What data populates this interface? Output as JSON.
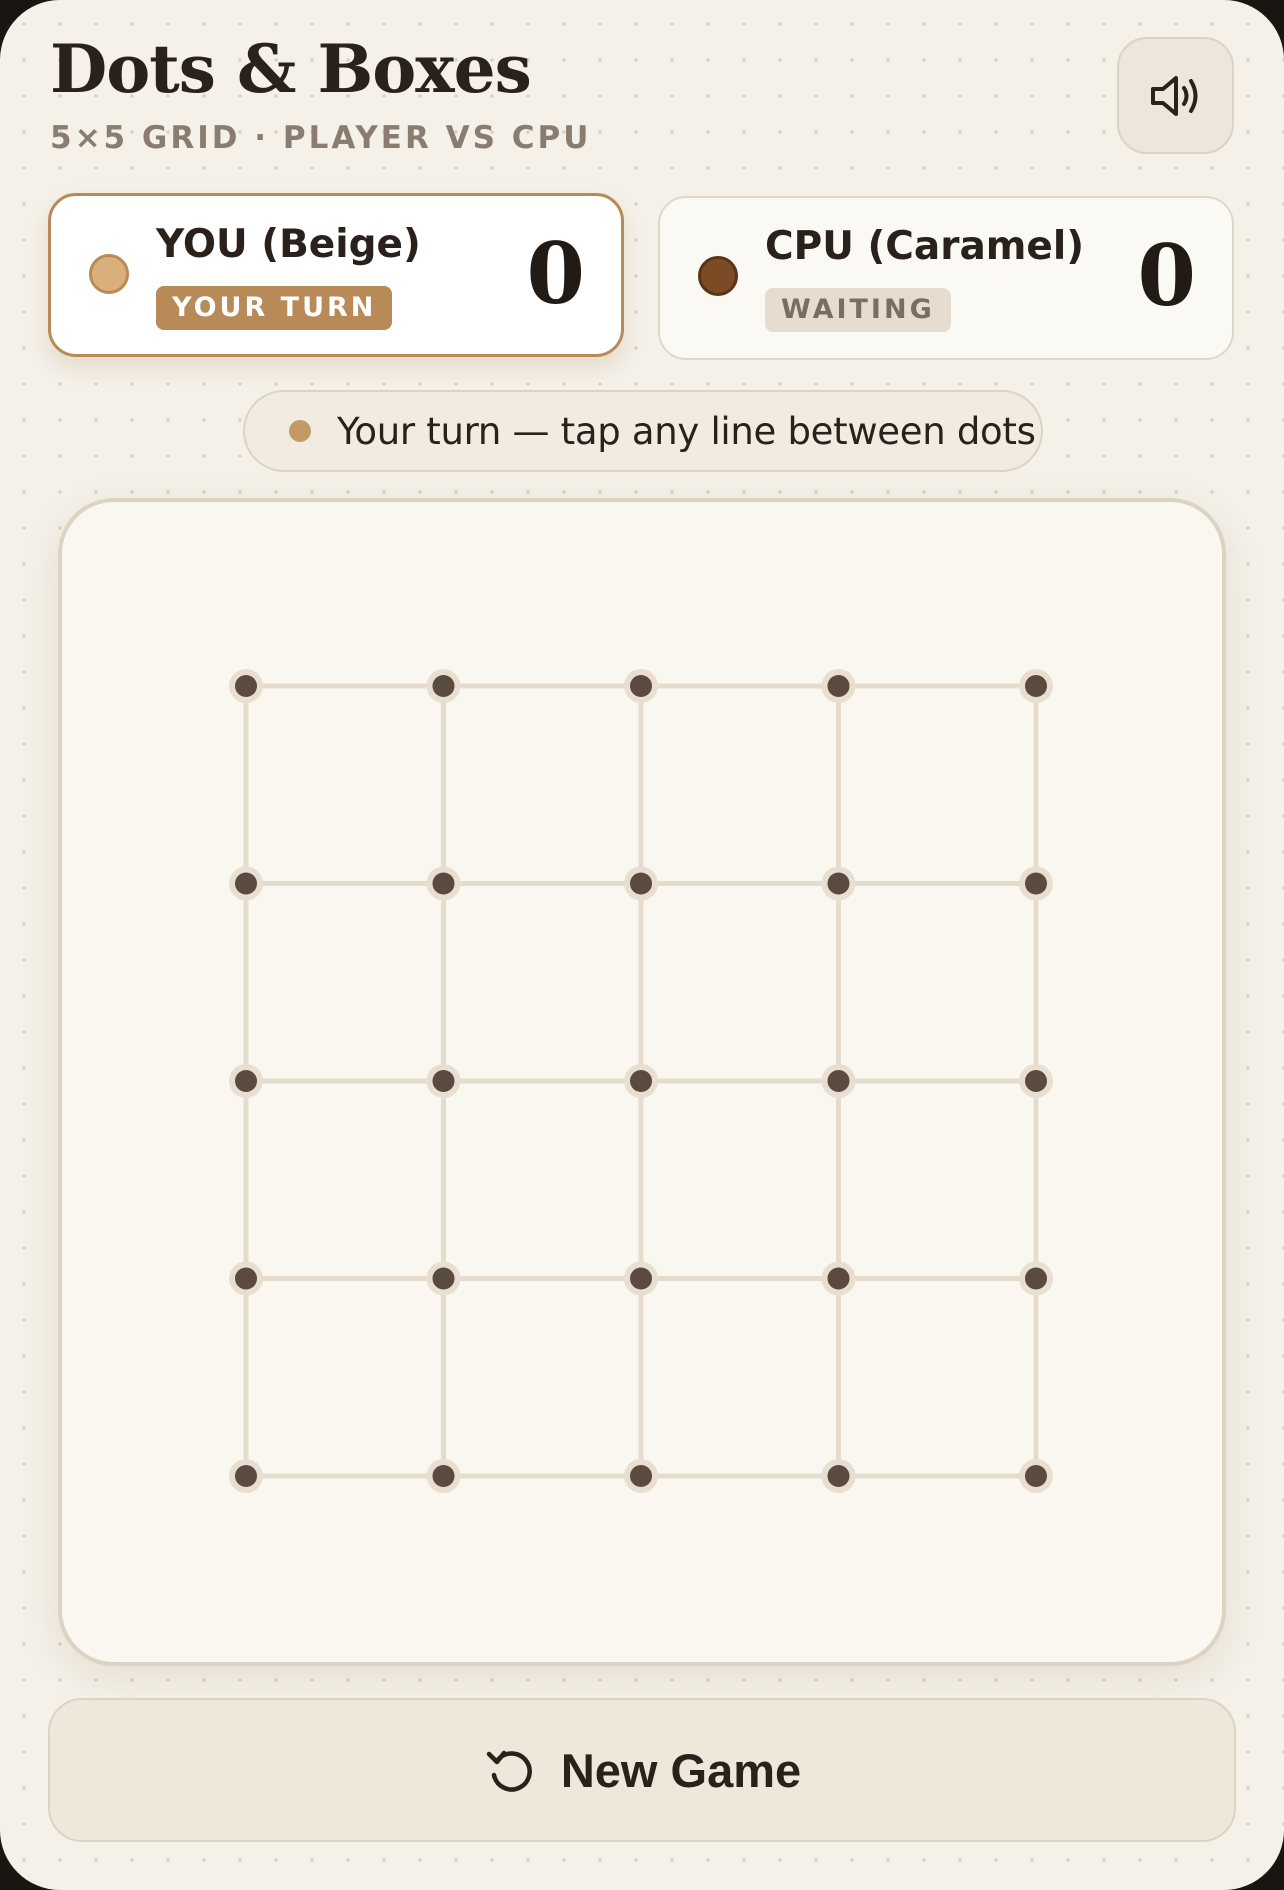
{
  "header": {
    "title": "Dots & Boxes",
    "subtitle": "5×5 GRID · PLAYER VS CPU",
    "sound_icon": "speaker-icon"
  },
  "players": [
    {
      "name": "YOU (Beige)",
      "badge": "YOUR TURN",
      "score": "0",
      "color": "#d9b07c",
      "active": true
    },
    {
      "name": "CPU (Caramel)",
      "badge": "WAITING",
      "score": "0",
      "color": "#7c4a24",
      "active": false
    }
  ],
  "status": {
    "text": "Your turn — tap any line between dots",
    "dot_color": "#c19a66"
  },
  "board": {
    "dots_per_side": 5,
    "dot_color": "#5a4a40",
    "line_color": "#e5dccd",
    "claimed_lines": 0
  },
  "actions": {
    "new_game_label": "New Game",
    "new_game_icon": "restart-icon"
  },
  "colors": {
    "accent": "#b78a58",
    "background": "#f5f1e9"
  }
}
